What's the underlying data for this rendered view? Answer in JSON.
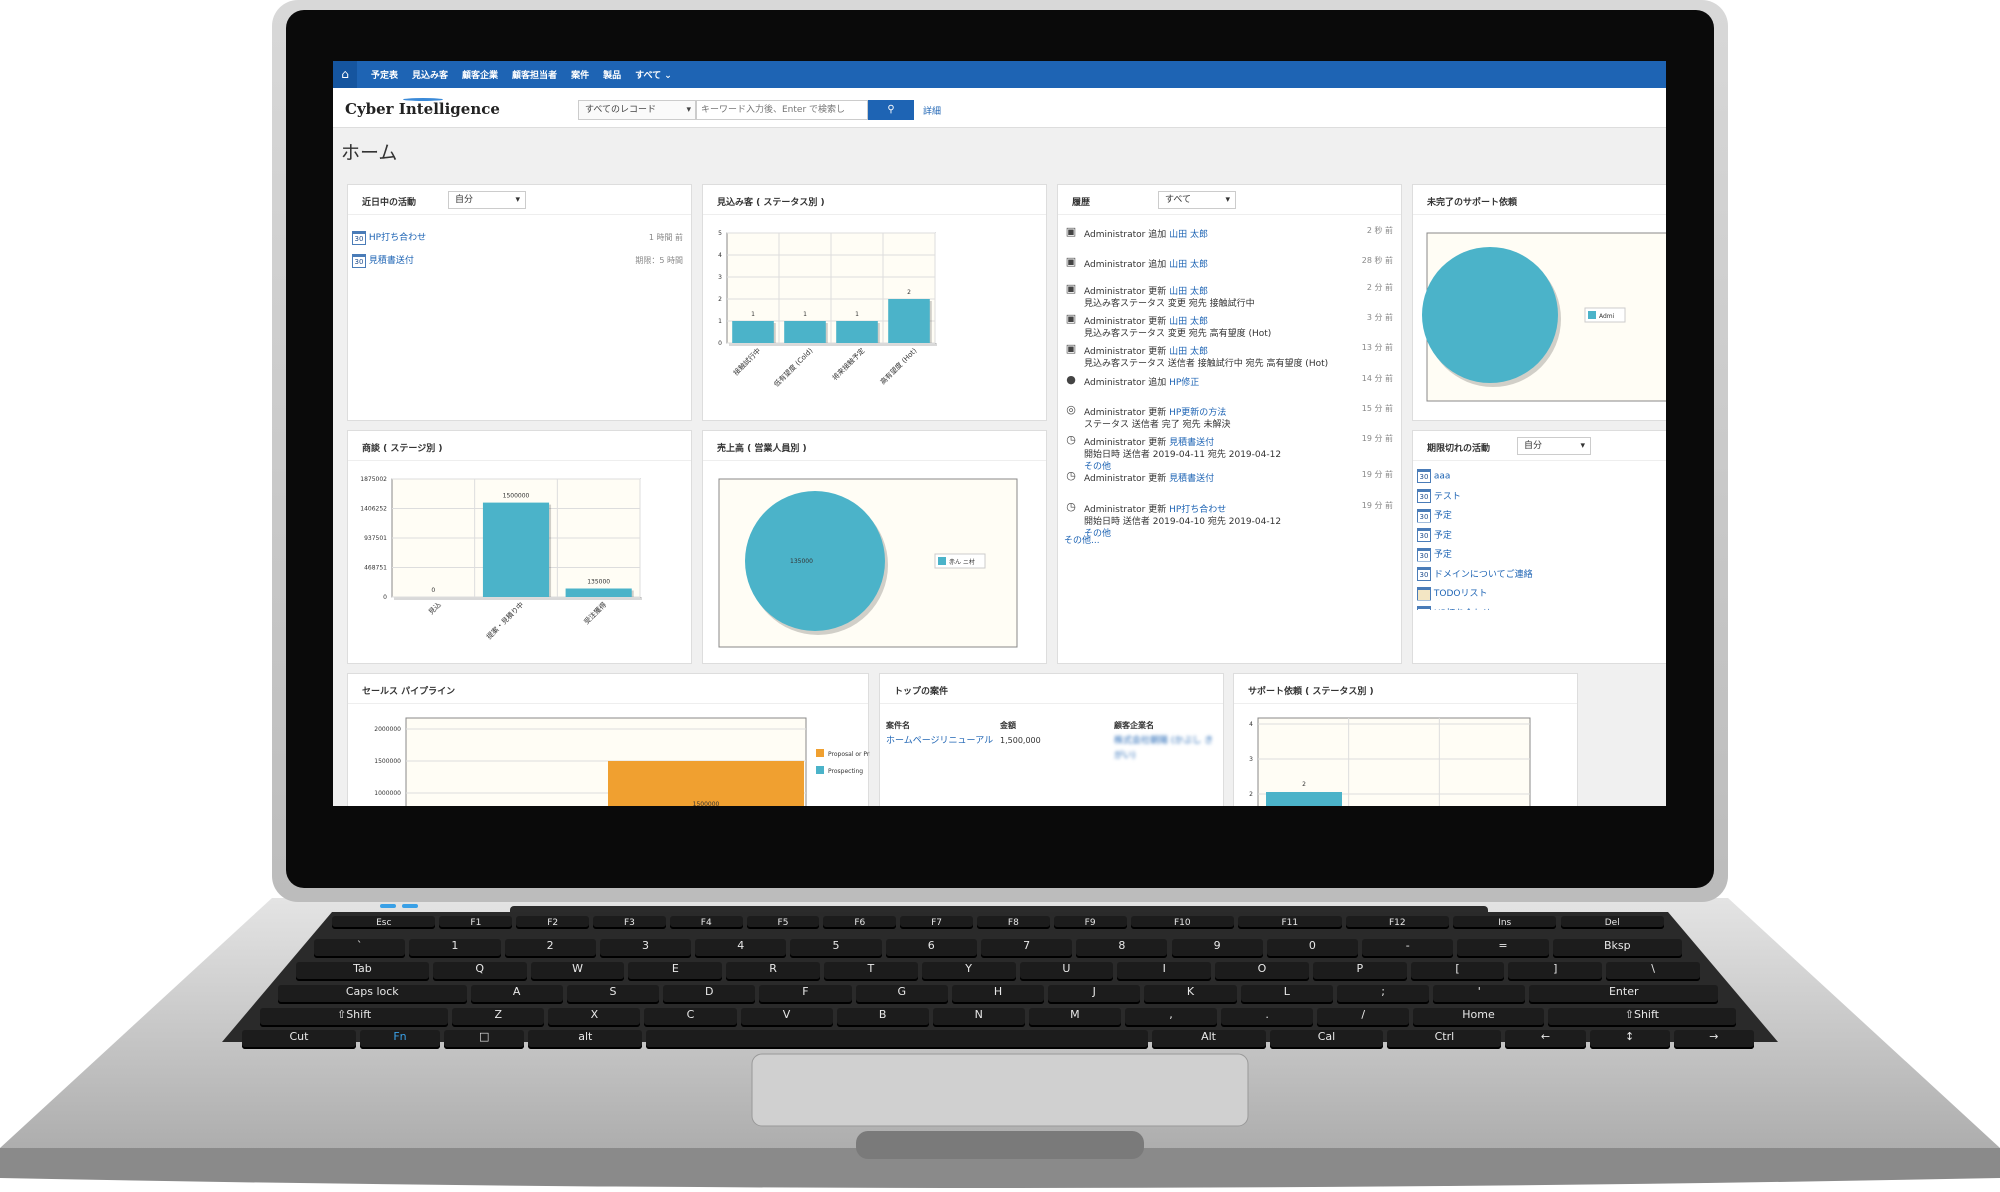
{
  "app": {
    "title": "ホーム",
    "logo": "Cyber Intelligence"
  },
  "nav": {
    "items": [
      "予定表",
      "見込み客",
      "顧客企業",
      "顧客担当者",
      "案件",
      "製品",
      "すべて ⌄"
    ]
  },
  "search": {
    "scope": "すべてのレコード",
    "placeholder": "キーワード入力後、Enter で検索し",
    "detail": "詳細"
  },
  "panels": {
    "recent": {
      "title": "近日中の活動",
      "filter": "自分",
      "items": [
        {
          "label": "HP打ち合わせ",
          "time": "1 時間 前"
        },
        {
          "label": "見積書送付",
          "time": "期限：5 時間"
        }
      ]
    },
    "leads": {
      "title": "見込み客 ( ステータス別 )"
    },
    "history": {
      "title": "履歴",
      "filter": "すべて",
      "items": [
        {
          "actor": "Administrator",
          "action": "追加",
          "target": "山田 太郎",
          "detail": "",
          "time": "2 秒 前"
        },
        {
          "actor": "Administrator",
          "action": "追加",
          "target": "山田 太郎",
          "detail": "",
          "time": "28 秒 前"
        },
        {
          "actor": "Administrator",
          "action": "更新",
          "target": "山田 太郎",
          "detail": "見込み客ステータス 変更 宛先 接触試行中",
          "time": "2 分 前"
        },
        {
          "actor": "Administrator",
          "action": "更新",
          "target": "山田 太郎",
          "detail": "見込み客ステータス 変更 宛先 高有望度 (Hot)",
          "time": "3 分 前"
        },
        {
          "actor": "Administrator",
          "action": "更新",
          "target": "山田 太郎",
          "detail": "見込み客ステータス 送信者 接触試行中 宛先 高有望度 (Hot)",
          "time": "13 分 前"
        },
        {
          "actor": "Administrator",
          "action": "追加",
          "target": "HP修正",
          "detail": "",
          "time": "14 分 前"
        },
        {
          "actor": "Administrator",
          "action": "更新",
          "target": "HP更新の方法",
          "detail": "ステータス 送信者 完了 宛先 未解決",
          "time": "15 分 前"
        },
        {
          "actor": "Administrator",
          "action": "更新",
          "target": "見積書送付",
          "detail": "開始日時 送信者 2019-04-11 宛先 2019-04-12",
          "more": "その他",
          "time": "19 分 前"
        },
        {
          "actor": "Administrator",
          "action": "更新",
          "target": "見積書送付",
          "detail": "",
          "time": "19 分 前"
        },
        {
          "actor": "Administrator",
          "action": "更新",
          "target": "HP打ち合わせ",
          "detail": "開始日時 送信者 2019-04-10 宛先 2019-04-12",
          "more": "その他",
          "time": "19 分 前"
        }
      ],
      "more": "その他..."
    },
    "support": {
      "title": "未完了のサポート依頼"
    },
    "deals": {
      "title": "商談 ( ステージ別 )"
    },
    "sales": {
      "title": "売上高 ( 営業人員別 )"
    },
    "overdue": {
      "title": "期限切れの活動",
      "filter": "自分",
      "items": [
        "aaa",
        "テスト",
        "予定",
        "予定",
        "予定",
        "ドメインについてご連絡",
        "TODOリスト",
        "HP打ち合わせ"
      ]
    },
    "pipeline": {
      "title": "セールス パイプライン"
    },
    "topdeals": {
      "title": "トップの案件",
      "headers": [
        "案件名",
        "金額",
        "顧客企業名"
      ],
      "rows": [
        {
          "name": "ホームページリニューアル",
          "amount": "1,500,000",
          "company": "株式会社朝陽 (かぶし きがい)"
        }
      ]
    },
    "supportstatus": {
      "title": "サポート依頼 ( ステータス別 )"
    }
  },
  "chart_data": [
    {
      "type": "bar",
      "title": "見込み客 ( ステータス別 )",
      "categories": [
        "接触試行中",
        "低有望度 (Cold)",
        "将来接触予定",
        "高有望度 (Hot)"
      ],
      "values": [
        1,
        1,
        1,
        2
      ],
      "ylim": [
        0,
        5
      ],
      "yticks": [
        "0",
        "1",
        "2",
        "3",
        "4",
        "5"
      ],
      "color": "#4bb3c9"
    },
    {
      "type": "pie",
      "title": "未完了のサポート依頼",
      "values": [
        1
      ],
      "legend": [
        "Admi"
      ],
      "color": "#4bb3c9"
    },
    {
      "type": "bar",
      "title": "商談 ( ステージ別 )",
      "categories": [
        "見込",
        "提案・見積り中",
        "受注獲得"
      ],
      "values": [
        0,
        1500000,
        135000
      ],
      "ylim": [
        0,
        1875002
      ],
      "yticks": [
        "0",
        "468751",
        "937501",
        "1406252",
        "1875002"
      ],
      "color": "#4bb3c9"
    },
    {
      "type": "pie",
      "title": "売上高 ( 営業人員別 )",
      "values": [
        135000
      ],
      "labels": [
        "135000"
      ],
      "legend": [
        "赤ん ニ村"
      ],
      "color": "#4bb3c9"
    },
    {
      "type": "bar",
      "title": "セールス パイプライン",
      "categories": [
        "Proposal or Price Quote",
        "Prospecting"
      ],
      "values": [
        1500000,
        0
      ],
      "yticks": [
        "1000000",
        "1500000",
        "2000000"
      ],
      "legend": [
        "Proposal or Pric",
        "Prospecting"
      ],
      "colors": [
        "#f0a030",
        "#4bb3c9"
      ]
    },
    {
      "type": "bar",
      "title": "サポート依頼 ( ステータス別 )",
      "values": [
        2
      ],
      "yticks": [
        "2",
        "3",
        "4"
      ],
      "color": "#4bb3c9"
    }
  ],
  "keyboard": {
    "rows": [
      [
        "Esc",
        "F1",
        "F2",
        "F3",
        "F4",
        "F5",
        "F6",
        "F7",
        "F8",
        "F9",
        "F10",
        "F11",
        "F12",
        "Ins",
        "Del"
      ],
      [
        "`",
        "1",
        "2",
        "3",
        "4",
        "5",
        "6",
        "7",
        "8",
        "9",
        "0",
        "-",
        "=",
        "Bksp"
      ],
      [
        "Tab",
        "Q",
        "W",
        "E",
        "R",
        "T",
        "Y",
        "U",
        "I",
        "O",
        "P",
        "[",
        "]",
        "\\"
      ],
      [
        "Caps lock",
        "A",
        "S",
        "D",
        "F",
        "G",
        "H",
        "J",
        "K",
        "L",
        ";",
        "'",
        "Enter"
      ],
      [
        "⇧Shift",
        "Z",
        "X",
        "C",
        "V",
        "B",
        "N",
        "M",
        ",",
        ".",
        "/",
        "Home",
        "⇧Shift"
      ],
      [
        "Cut",
        "Fn",
        "□",
        "alt",
        "",
        "Alt",
        "Cal",
        "Ctrl",
        "←",
        "↕",
        "→"
      ]
    ]
  }
}
